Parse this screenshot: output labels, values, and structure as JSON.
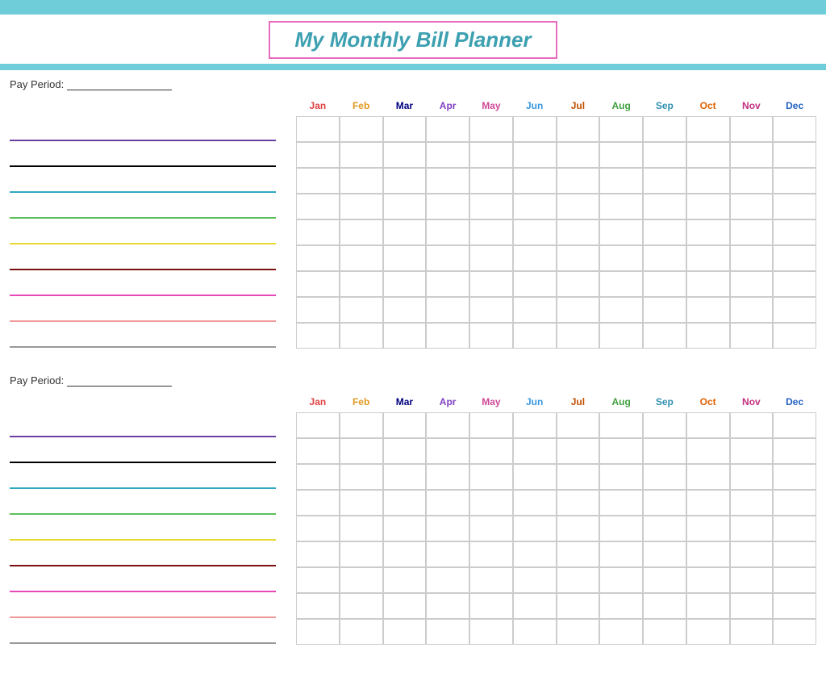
{
  "header": {
    "title": "My Monthly Bill Planner"
  },
  "payPeriod1": {
    "label": "Pay Period:",
    "line": ""
  },
  "payPeriod2": {
    "label": "Pay Period:",
    "line": ""
  },
  "months": [
    {
      "label": "Jan",
      "class": "m-jan"
    },
    {
      "label": "Feb",
      "class": "m-feb"
    },
    {
      "label": "Mar",
      "class": "m-mar"
    },
    {
      "label": "Apr",
      "class": "m-apr"
    },
    {
      "label": "May",
      "class": "m-may"
    },
    {
      "label": "Jun",
      "class": "m-jun"
    },
    {
      "label": "Jul",
      "class": "m-jul"
    },
    {
      "label": "Aug",
      "class": "m-aug"
    },
    {
      "label": "Sep",
      "class": "m-sep"
    },
    {
      "label": "Oct",
      "class": "m-oct"
    },
    {
      "label": "Nov",
      "class": "m-nov"
    },
    {
      "label": "Dec",
      "class": "m-dec"
    }
  ],
  "billLines1": [
    "line-color-purple",
    "line-color-black",
    "line-color-teal",
    "line-color-green",
    "line-color-yellow",
    "line-color-darkred",
    "line-color-pink",
    "line-color-lightpink",
    "line-color-gray"
  ],
  "billLines2": [
    "line-color-purple",
    "line-color-black",
    "line-color-teal",
    "line-color-green",
    "line-color-yellow",
    "line-color-darkred",
    "line-color-pink",
    "line-color-lightpink",
    "line-color-gray"
  ]
}
